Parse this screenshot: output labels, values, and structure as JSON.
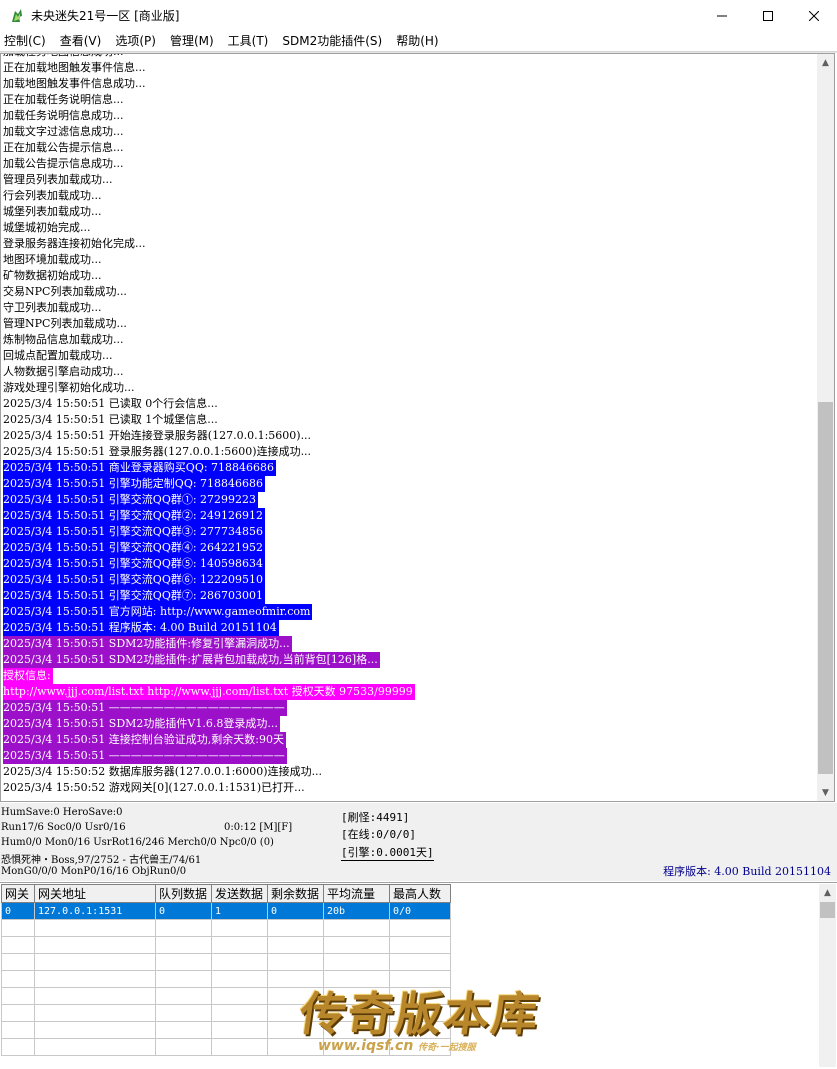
{
  "window": {
    "title": "未央迷失21号一区 [商业版]"
  },
  "menu": [
    "控制(C)",
    "查看(V)",
    "选项(P)",
    "管理(M)",
    "工具(T)",
    "SDM2功能插件(S)",
    "帮助(H)"
  ],
  "log": [
    {
      "text": "加载任务地图信息成功...",
      "style": ""
    },
    {
      "text": "正在加载地图触发事件信息...",
      "style": ""
    },
    {
      "text": "加载地图触发事件信息成功...",
      "style": ""
    },
    {
      "text": "正在加载任务说明信息...",
      "style": ""
    },
    {
      "text": "加载任务说明信息成功...",
      "style": ""
    },
    {
      "text": "加载文字过滤信息成功...",
      "style": ""
    },
    {
      "text": "正在加载公告提示信息...",
      "style": ""
    },
    {
      "text": "加载公告提示信息成功...",
      "style": ""
    },
    {
      "text": "管理员列表加载成功...",
      "style": ""
    },
    {
      "text": "行会列表加载成功...",
      "style": ""
    },
    {
      "text": "城堡列表加载成功...",
      "style": ""
    },
    {
      "text": "城堡城初始完成...",
      "style": ""
    },
    {
      "text": "登录服务器连接初始化完成...",
      "style": ""
    },
    {
      "text": "地图环境加载成功...",
      "style": ""
    },
    {
      "text": "矿物数据初始成功...",
      "style": ""
    },
    {
      "text": "交易NPC列表加载成功...",
      "style": ""
    },
    {
      "text": "守卫列表加载成功...",
      "style": ""
    },
    {
      "text": "管理NPC列表加载成功...",
      "style": ""
    },
    {
      "text": "炼制物品信息加载成功...",
      "style": ""
    },
    {
      "text": "回城点配置加载成功...",
      "style": ""
    },
    {
      "text": "人物数据引擎启动成功...",
      "style": ""
    },
    {
      "text": "游戏处理引擎初始化成功...",
      "style": ""
    },
    {
      "text": "2025/3/4 15:50:51 已读取 0个行会信息...",
      "style": ""
    },
    {
      "text": "2025/3/4 15:50:51 已读取 1个城堡信息...",
      "style": ""
    },
    {
      "text": "2025/3/4 15:50:51 开始连接登录服务器(127.0.0.1:5600)...",
      "style": ""
    },
    {
      "text": "2025/3/4 15:50:51 登录服务器(127.0.0.1:5600)连接成功...",
      "style": ""
    },
    {
      "text": "2025/3/4 15:50:51 商业登录器购买QQ: 718846686",
      "style": "hl-blue"
    },
    {
      "text": "2025/3/4 15:50:51 引擎功能定制QQ: 718846686",
      "style": "hl-blue"
    },
    {
      "text": "2025/3/4 15:50:51 引擎交流QQ群①: 27299223",
      "style": "hl-blue"
    },
    {
      "text": "2025/3/4 15:50:51 引擎交流QQ群②: 249126912",
      "style": "hl-blue"
    },
    {
      "text": "2025/3/4 15:50:51 引擎交流QQ群③: 277734856",
      "style": "hl-blue"
    },
    {
      "text": "2025/3/4 15:50:51 引擎交流QQ群④: 264221952",
      "style": "hl-blue"
    },
    {
      "text": "2025/3/4 15:50:51 引擎交流QQ群⑤: 140598634",
      "style": "hl-blue"
    },
    {
      "text": "2025/3/4 15:50:51 引擎交流QQ群⑥: 122209510",
      "style": "hl-blue"
    },
    {
      "text": "2025/3/4 15:50:51 引擎交流QQ群⑦: 286703001",
      "style": "hl-blue"
    },
    {
      "text": "2025/3/4 15:50:51 官方网站: http://www.gameofmir.com",
      "style": "hl-blue"
    },
    {
      "text": "2025/3/4 15:50:51 程序版本: 4.00 Build 20151104",
      "style": "hl-blue"
    },
    {
      "text": "2025/3/4 15:50:51 SDM2功能插件:修复引擎漏洞成功...",
      "style": "hl-violet"
    },
    {
      "text": "2025/3/4 15:50:51 SDM2功能插件:扩展背包加载成功,当前背包[126]格...",
      "style": "hl-violet"
    },
    {
      "text": "授权信息:",
      "style": "hl-magenta"
    },
    {
      "text": "http://www.jjj.com/list.txt http://www.jjj.com/list.txt 授权天数 97533/99999",
      "style": "hl-magenta"
    },
    {
      "text": "2025/3/4 15:50:51 ————————————————",
      "style": "hl-violet"
    },
    {
      "text": "2025/3/4 15:50:51 SDM2功能插件V1.6.8登录成功...",
      "style": "hl-violet"
    },
    {
      "text": "2025/3/4 15:50:51 连接控制台验证成功,剩余天数:90天",
      "style": "hl-violet"
    },
    {
      "text": "2025/3/4 15:50:51 ————————————————",
      "style": "hl-violet"
    },
    {
      "text": "2025/3/4 15:50:52 数据库服务器(127.0.0.1:6000)连接成功...",
      "style": ""
    },
    {
      "text": "2025/3/4 15:50:52 游戏网关[0](127.0.0.1:1531)已打开...",
      "style": ""
    }
  ],
  "status": {
    "line1": "HumSave:0 HeroSave:0",
    "line2": "Run17/6 Soc0/0 Usr0/16",
    "timer": "0:0:12 [M][F]",
    "line3": "Hum0/0 Mon0/16 UsrRot16/246 Merch0/0 Npc0/0 (0)",
    "line4": "恐惧死神・Boss,97/2752 - 古代兽王/74/61",
    "line5": "MonG0/0/0 MonP0/16/16 ObjRun0/0",
    "box1": "[刷怪:4491]",
    "box2": "[在线:0/0/0]",
    "box3": "[引擎:0.0001天]",
    "version": "程序版本: 4.00 Build 20151104"
  },
  "gateway_table": {
    "headers": [
      "网关",
      "网关地址",
      "队列数据",
      "发送数据",
      "剩余数据",
      "平均流量",
      "最高人数"
    ],
    "rows": [
      [
        "0",
        "127.0.0.1:1531",
        "0",
        "1",
        "0",
        "20b",
        "0/0"
      ]
    ]
  },
  "watermark": {
    "title": "传奇版本库",
    "url": "www.iqsf.cn",
    "tagline": "传奇·一起搜服"
  },
  "colors": {
    "highlight_blue": "#0000ff",
    "highlight_violet": "#9b10c8",
    "highlight_magenta": "#ff00ff",
    "selection": "#0078d7",
    "version_text": "#00008b"
  }
}
